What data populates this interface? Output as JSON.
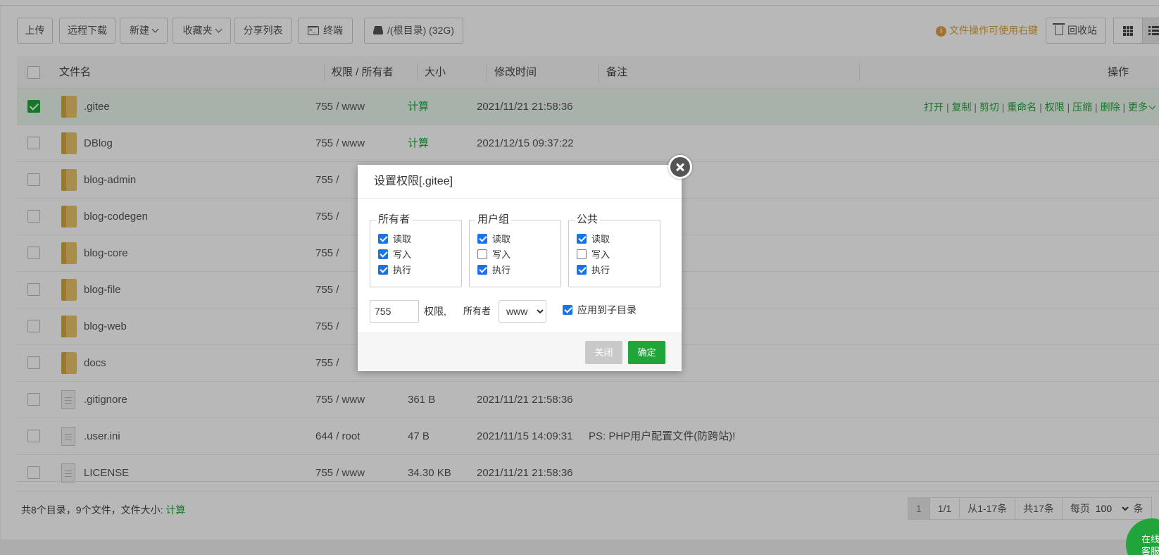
{
  "toolbar": {
    "upload": "上传",
    "remote_download": "远程下载",
    "new": "新建",
    "favorites": "收藏夹",
    "share_list": "分享列表",
    "terminal": "终端",
    "disk": "/(根目录) (32G)",
    "tip": "文件操作可使用右键",
    "recycle": "回收站"
  },
  "table": {
    "headers": {
      "name": "文件名",
      "perm": "权限 / 所有者",
      "size": "大小",
      "mtime": "修改时间",
      "remark": "备注",
      "ops": "操作"
    },
    "ops": [
      "打开",
      "复制",
      "剪切",
      "重命名",
      "权限",
      "压缩",
      "删除",
      "更多"
    ],
    "ops_sep": "|",
    "rows": [
      {
        "type": "folder",
        "name": ".gitee",
        "perm": "755 / www",
        "size": "计算",
        "mtime": "2021/11/21 21:58:36",
        "remark": "",
        "selected": true
      },
      {
        "type": "folder",
        "name": "DBlog",
        "perm": "755 / www",
        "size": "计算",
        "mtime": "2021/12/15 09:37:22",
        "remark": "",
        "selected": false
      },
      {
        "type": "folder",
        "name": "blog-admin",
        "perm": "755 /",
        "size": "",
        "mtime": "",
        "remark": "",
        "selected": false
      },
      {
        "type": "folder",
        "name": "blog-codegen",
        "perm": "755 /",
        "size": "",
        "mtime": "",
        "remark": "",
        "selected": false
      },
      {
        "type": "folder",
        "name": "blog-core",
        "perm": "755 /",
        "size": "",
        "mtime": "",
        "remark": "",
        "selected": false
      },
      {
        "type": "folder",
        "name": "blog-file",
        "perm": "755 /",
        "size": "",
        "mtime": "",
        "remark": "",
        "selected": false
      },
      {
        "type": "folder",
        "name": "blog-web",
        "perm": "755 /",
        "size": "",
        "mtime": "",
        "remark": "",
        "selected": false
      },
      {
        "type": "folder",
        "name": "docs",
        "perm": "755 /",
        "size": "",
        "mtime": "",
        "remark": "",
        "selected": false
      },
      {
        "type": "file",
        "name": ".gitignore",
        "perm": "755 / www",
        "size": "361 B",
        "mtime": "2021/11/21 21:58:36",
        "remark": "",
        "selected": false
      },
      {
        "type": "file",
        "name": ".user.ini",
        "perm": "644 / root",
        "size": "47 B",
        "mtime": "2021/11/15 14:09:31",
        "remark": "PS: PHP用户配置文件(防跨站)!",
        "selected": false
      },
      {
        "type": "file",
        "name": "LICENSE",
        "perm": "755 / www",
        "size": "34.30 KB",
        "mtime": "2021/11/21 21:58:36",
        "remark": "",
        "selected": false
      }
    ]
  },
  "footer": {
    "summary_prefix": "共8个目录，9个文件，文件大小: ",
    "summary_calc": "计算",
    "page_current": "1",
    "page_total": "1/1",
    "range": "从1-17条",
    "total": "共17条",
    "per_page_label": "每页",
    "per_page_value": "100",
    "per_page_suffix": "条",
    "service_line1": "在线",
    "service_line2": "客服"
  },
  "dialog": {
    "title": "设置权限[.gitee]",
    "groups": [
      {
        "legend": "所有者",
        "read": true,
        "write": true,
        "exec": true
      },
      {
        "legend": "用户组",
        "read": true,
        "write": false,
        "exec": true
      },
      {
        "legend": "公共",
        "read": true,
        "write": false,
        "exec": true
      }
    ],
    "labels": {
      "read": "读取",
      "write": "写入",
      "exec": "执行"
    },
    "perm_value": "755",
    "perm_label": "权限,",
    "owner_label": "所有者",
    "owner_value": "www",
    "apply_sub": "应用到子目录",
    "apply_sub_checked": true,
    "btn_close": "关闭",
    "btn_ok": "确定"
  },
  "colors": {
    "accent": "#20a53a",
    "tip": "#e0a03c",
    "checkbox_blue": "#1a73e8"
  }
}
